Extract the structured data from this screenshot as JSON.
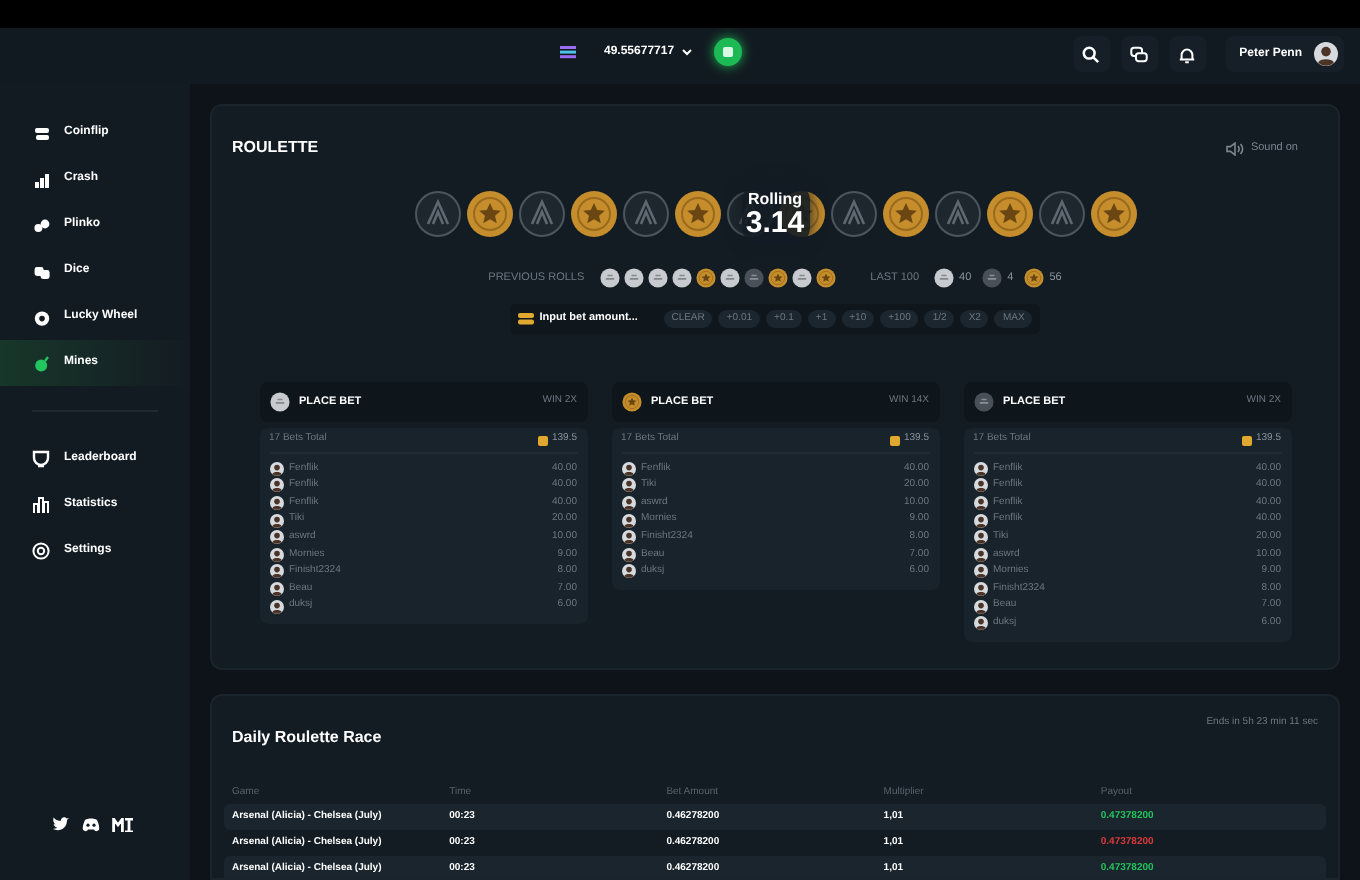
{
  "header": {
    "balance": "49.55677717",
    "user": "Peter Penn"
  },
  "sidebar": {
    "games": [
      {
        "label": "Coinflip",
        "selected": false
      },
      {
        "label": "Crash",
        "selected": false
      },
      {
        "label": "Plinko",
        "selected": false
      },
      {
        "label": "Dice",
        "selected": false
      },
      {
        "label": "Lucky Wheel",
        "selected": false
      },
      {
        "label": "Mines",
        "selected": true
      }
    ],
    "links": [
      {
        "label": "Leaderboard"
      },
      {
        "label": "Statistics"
      },
      {
        "label": "Settings"
      }
    ]
  },
  "roulette": {
    "title": "ROULETTE",
    "sound": "Sound on",
    "wheel": [
      {
        "kind": "grey"
      },
      {
        "kind": "gold"
      },
      {
        "kind": "grey"
      },
      {
        "kind": "gold"
      },
      {
        "kind": "grey"
      },
      {
        "kind": "gold"
      },
      {
        "kind": "grey"
      },
      {
        "kind": "gold"
      },
      {
        "kind": "grey"
      },
      {
        "kind": "gold"
      },
      {
        "kind": "grey"
      },
      {
        "kind": "gold"
      },
      {
        "kind": "grey"
      },
      {
        "kind": "gold"
      }
    ],
    "rolling_label": "Rolling",
    "rolling_value": "3.14",
    "previous_label": "PREVIOUS ROLLS",
    "previous": [
      {
        "kind": "silver"
      },
      {
        "kind": "silver"
      },
      {
        "kind": "silver"
      },
      {
        "kind": "silver"
      },
      {
        "kind": "gold"
      },
      {
        "kind": "silver"
      },
      {
        "kind": "dark"
      },
      {
        "kind": "gold"
      },
      {
        "kind": "silver"
      },
      {
        "kind": "gold"
      }
    ],
    "last100_label": "LAST 100",
    "last100": [
      {
        "kind": "silver",
        "count": "40"
      },
      {
        "kind": "dark",
        "count": "4"
      },
      {
        "kind": "gold",
        "count": "56"
      }
    ],
    "bet_placeholder": "Input bet amount...",
    "bet_buttons": [
      "CLEAR",
      "+0.01",
      "+0.1",
      "+1",
      "+10",
      "+100",
      "1/2",
      "X2",
      "MAX"
    ],
    "columns": [
      {
        "kind": "silver",
        "action": "PLACE BET",
        "win": "WIN 2X",
        "total_label": "17 Bets Total",
        "total": "139.5",
        "bets": [
          {
            "user": "Fenflik",
            "amount": "40.00"
          },
          {
            "user": "Fenflik",
            "amount": "40.00"
          },
          {
            "user": "Fenflik",
            "amount": "40.00"
          },
          {
            "user": "Tiki",
            "amount": "20.00"
          },
          {
            "user": "aswrd",
            "amount": "10.00"
          },
          {
            "user": "Mornies",
            "amount": "9.00"
          },
          {
            "user": "Finisht2324",
            "amount": "8.00"
          },
          {
            "user": "Beau",
            "amount": "7.00"
          },
          {
            "user": "duksj",
            "amount": "6.00"
          }
        ]
      },
      {
        "kind": "gold",
        "action": "PLACE BET",
        "win": "WIN 14X",
        "total_label": "17 Bets Total",
        "total": "139.5",
        "bets": [
          {
            "user": "Fenflik",
            "amount": "40.00"
          },
          {
            "user": "Tiki",
            "amount": "20.00"
          },
          {
            "user": "aswrd",
            "amount": "10.00"
          },
          {
            "user": "Mornies",
            "amount": "9.00"
          },
          {
            "user": "Finisht2324",
            "amount": "8.00"
          },
          {
            "user": "Beau",
            "amount": "7.00"
          },
          {
            "user": "duksj",
            "amount": "6.00"
          }
        ]
      },
      {
        "kind": "dark",
        "action": "PLACE BET",
        "win": "WIN 2X",
        "total_label": "17 Bets Total",
        "total": "139.5",
        "bets": [
          {
            "user": "Fenflik",
            "amount": "40.00"
          },
          {
            "user": "Fenflik",
            "amount": "40.00"
          },
          {
            "user": "Fenflik",
            "amount": "40.00"
          },
          {
            "user": "Fenflik",
            "amount": "40.00"
          },
          {
            "user": "Tiki",
            "amount": "20.00"
          },
          {
            "user": "aswrd",
            "amount": "10.00"
          },
          {
            "user": "Mornies",
            "amount": "9.00"
          },
          {
            "user": "Finisht2324",
            "amount": "8.00"
          },
          {
            "user": "Beau",
            "amount": "7.00"
          },
          {
            "user": "duksj",
            "amount": "6.00"
          }
        ]
      }
    ]
  },
  "race": {
    "title": "Daily Roulette Race",
    "ends": "Ends in 5h 23 min 11 sec",
    "columns": [
      "Game",
      "Time",
      "Bet Amount",
      "Multiplier",
      "Payout"
    ],
    "rows": [
      {
        "game": "Arsenal (Alicia) - Chelsea (July)",
        "time": "00:23",
        "bet": "0.46278200",
        "multiplier": "1,01",
        "payout": "0.47378200",
        "win": true
      },
      {
        "game": "Arsenal (Alicia) - Chelsea (July)",
        "time": "00:23",
        "bet": "0.46278200",
        "multiplier": "1,01",
        "payout": "0.47378200",
        "win": false
      },
      {
        "game": "Arsenal (Alicia) - Chelsea (July)",
        "time": "00:23",
        "bet": "0.46278200",
        "multiplier": "1,01",
        "payout": "0.47378200",
        "win": true
      }
    ]
  }
}
